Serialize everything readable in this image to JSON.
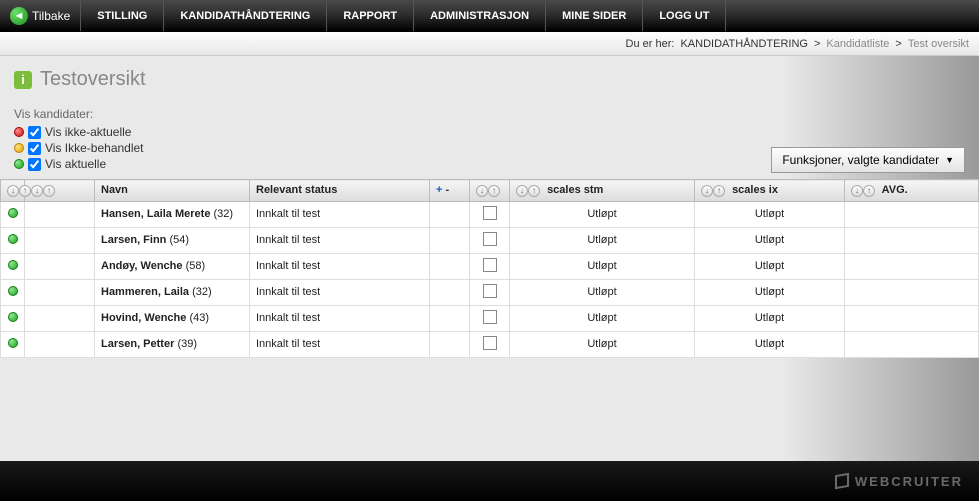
{
  "topnav": {
    "back": "Tilbake",
    "items": [
      "STILLING",
      "KANDIDATHÅNDTERING",
      "RAPPORT",
      "ADMINISTRASJON",
      "MINE SIDER",
      "LOGG UT"
    ]
  },
  "breadcrumb": {
    "prefix": "Du er her:",
    "items": [
      "KANDIDATHÅNDTERING",
      "Kandidatliste",
      "Test oversikt"
    ],
    "sep": ">"
  },
  "page_title": "Testoversikt",
  "filters": {
    "header": "Vis kandidater:",
    "items": [
      {
        "dot": "red",
        "label": "Vis ikke-aktuelle",
        "checked": true
      },
      {
        "dot": "yellow",
        "label": "Vis Ikke-behandlet",
        "checked": true
      },
      {
        "dot": "green",
        "label": "Vis aktuelle",
        "checked": true
      }
    ]
  },
  "functions_button": "Funksjoner, valgte kandidater",
  "table": {
    "headers": {
      "name": "Navn",
      "status": "Relevant status",
      "plus_minus": "+ -",
      "stm": "scales stm",
      "ix": "scales ix",
      "avg": "AVG."
    },
    "rows": [
      {
        "name_bold": "Hansen, Laila Merete",
        "age": "(32)",
        "status": "Innkalt til test",
        "stm": "Utløpt",
        "ix": "Utløpt"
      },
      {
        "name_bold": "Larsen, Finn",
        "age": "(54)",
        "status": "Innkalt til test",
        "stm": "Utløpt",
        "ix": "Utløpt"
      },
      {
        "name_bold": "Andøy, Wenche",
        "age": "(58)",
        "status": "Innkalt til test",
        "stm": "Utløpt",
        "ix": "Utløpt"
      },
      {
        "name_bold": "Hammeren, Laila",
        "age": "(32)",
        "status": "Innkalt til test",
        "stm": "Utløpt",
        "ix": "Utløpt"
      },
      {
        "name_bold": "Hovind, Wenche",
        "age": "(43)",
        "status": "Innkalt til test",
        "stm": "Utløpt",
        "ix": "Utløpt"
      },
      {
        "name_bold": "Larsen, Petter",
        "age": "(39)",
        "status": "Innkalt til test",
        "stm": "Utløpt",
        "ix": "Utløpt"
      }
    ]
  },
  "footer_brand": "WEBCRUITER"
}
